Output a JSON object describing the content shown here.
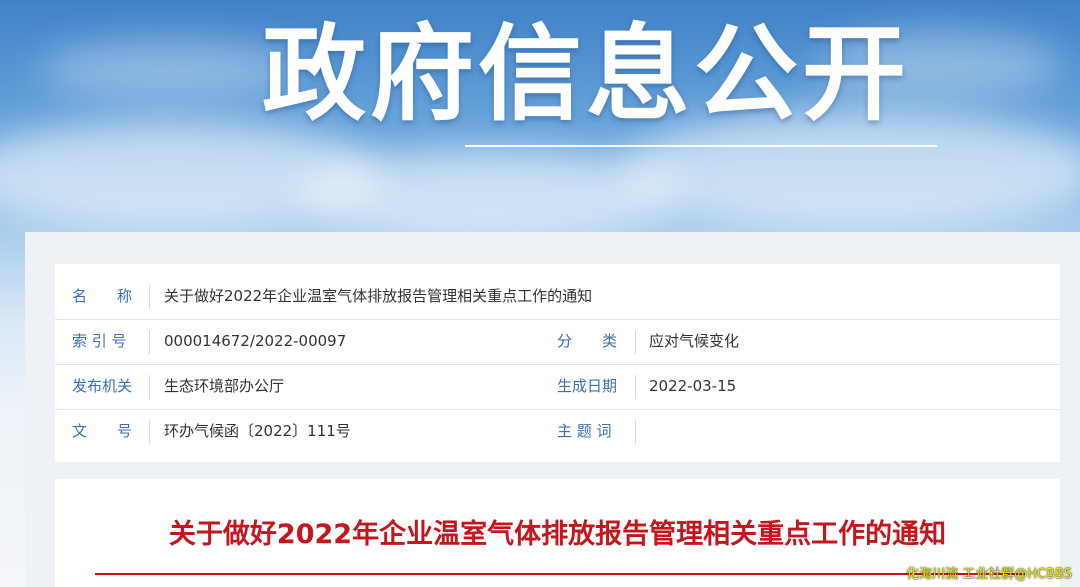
{
  "banner": {
    "title": "政府信息公开"
  },
  "info": {
    "name_label": "名　　称",
    "name_value": "关于做好2022年企业温室气体排放报告管理相关重点工作的通知",
    "index_label": "索 引 号",
    "index_value": "000014672/2022-00097",
    "category_label": "分　　类",
    "category_value": "应对气候变化",
    "issuer_label": "发布机关",
    "issuer_value": "生态环境部办公厅",
    "date_label": "生成日期",
    "date_value": "2022-03-15",
    "docno_label": "文　　号",
    "docno_value": "环办气候函〔2022〕111号",
    "topic_label": "主 题 词",
    "topic_value": ""
  },
  "document": {
    "title": "关于做好2022年企业温室气体排放报告管理相关重点工作的通知"
  },
  "watermark": {
    "text": "化海川流 工业社群@HCBBS"
  },
  "colors": {
    "label_blue": "#3a6fb4",
    "title_red": "#c4161c"
  }
}
